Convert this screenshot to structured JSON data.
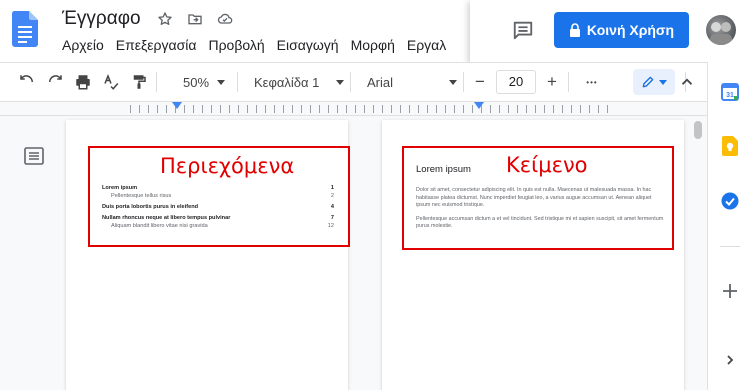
{
  "app": {
    "doc_title": "Έγγραφο",
    "menu": [
      "Αρχείο",
      "Επεξεργασία",
      "Προβολή",
      "Εισαγωγή",
      "Μορφή",
      "Εργαλ"
    ],
    "share_label": "Κοινή Χρήση"
  },
  "toolbar": {
    "zoom": "50%",
    "style": "Κεφαλίδα 1",
    "font": "Arial",
    "font_size": "20",
    "minus": "−",
    "plus": "+",
    "more": "•••"
  },
  "callouts": {
    "contents_label": "Περιεχόμενα",
    "text_label": "Κείμενο"
  },
  "toc": {
    "entries": [
      {
        "text": "Lorem ipsum",
        "page": "1",
        "level": 1
      },
      {
        "text": "Pellentesque tellus risus",
        "page": "2",
        "level": 2
      },
      {
        "text": "Duis porta lobortis purus in eleifend",
        "page": "4",
        "level": 1
      },
      {
        "text": "Nullam rhoncus neque at libero tempus pulvinar",
        "page": "7",
        "level": 1
      },
      {
        "text": "Aliquam blandit libero vitae nisi gravida",
        "page": "12",
        "level": 2
      }
    ]
  },
  "page2": {
    "heading": "Lorem ipsum",
    "para1": "Dolor sit amet, consectetur adipiscing elit. In quis est nulla. Maecenas ut malesuada massa. In hac habitasse platea dictumst. Nunc imperdiet feugiat leo, a varius augue accumsan ut. Aenean aliquet ipsum nec euismod tristique.",
    "para2": "Pellentesque accumsan dictum a et vel tincidunt. Sed tristique mi et sapien suscipit, sit amet fermentum purus molestie."
  },
  "colors": {
    "accent": "#1a73e8",
    "callout": "#e00000",
    "calendar": "#4285f4",
    "keep": "#fbbc04",
    "tasks": "#1a73e8"
  }
}
